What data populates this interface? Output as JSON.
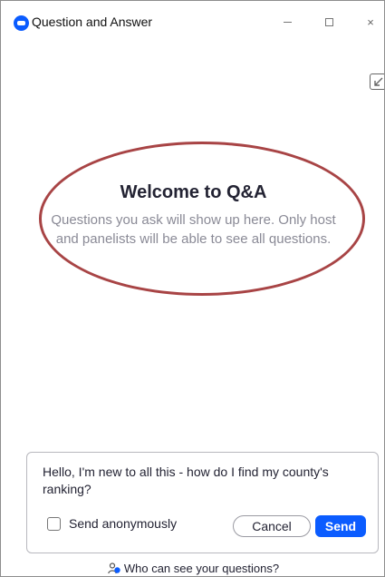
{
  "window": {
    "title": "Question and Answer",
    "brand_color": "#0b5cff"
  },
  "window_controls": {
    "minimize_icon": "minimize-icon",
    "maximize_icon": "maximize-icon",
    "close_icon": "close-icon"
  },
  "toolbar": {
    "popout_icon": "popout-icon"
  },
  "welcome": {
    "title": "Welcome to Q&A",
    "description": "Questions you ask will show up here. Only host and panelists will be able to see all questions.",
    "highlight_color": "#a84445"
  },
  "compose": {
    "question_value": "Hello, I'm new to all this - how do I find my county's ranking?",
    "anonymous_label": "Send anonymously",
    "anonymous_checked": false,
    "cancel_label": "Cancel",
    "send_label": "Send",
    "send_color": "#0b5cff"
  },
  "footer": {
    "link_text": "Who can see your questions?",
    "icon": "people-icon"
  }
}
